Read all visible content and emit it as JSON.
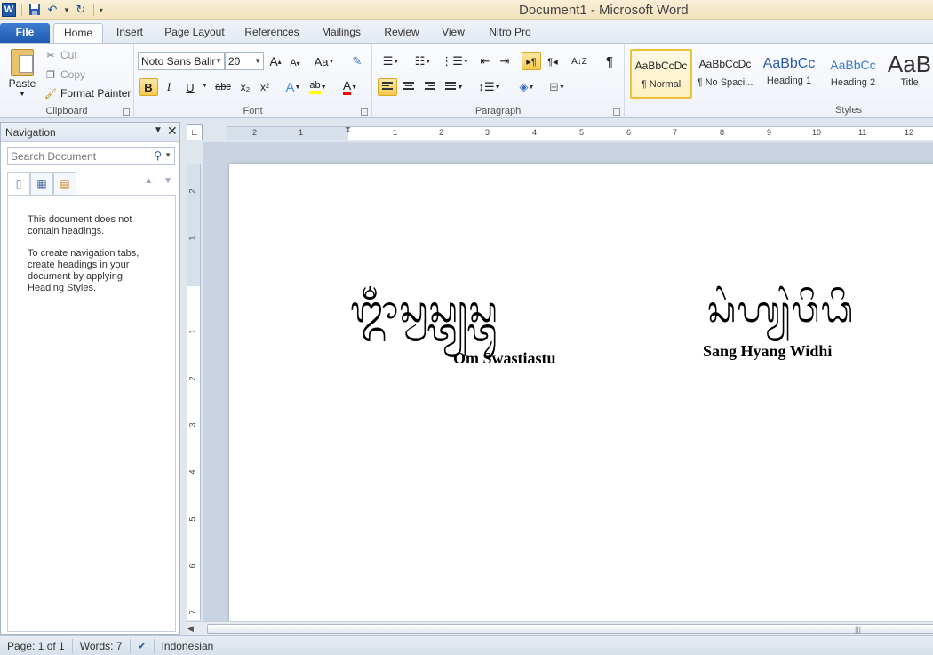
{
  "app": {
    "title": "Document1  -  Microsoft Word",
    "logo": "W"
  },
  "tabs": {
    "file": "File",
    "home": "Home",
    "insert": "Insert",
    "page_layout": "Page Layout",
    "references": "References",
    "mailings": "Mailings",
    "review": "Review",
    "view": "View",
    "nitro": "Nitro Pro"
  },
  "clipboard": {
    "paste": "Paste",
    "cut": "Cut",
    "copy": "Copy",
    "format_painter": "Format Painter",
    "label": "Clipboard"
  },
  "font": {
    "name": "Noto Sans Balir",
    "size": "20",
    "label": "Font",
    "grow": "A",
    "shrink": "A",
    "change_case": "Aa",
    "bold": "B",
    "italic": "I",
    "underline": "U",
    "strikethrough": "abc",
    "subscript": "x₂",
    "superscript": "x²",
    "text_effects": "A",
    "font_color": "A",
    "highlight_color": "#ffff00",
    "font_color_value": "#ff0000"
  },
  "paragraph": {
    "label": "Paragraph",
    "pilcrow": "¶"
  },
  "styles": {
    "label": "Styles",
    "items": [
      {
        "sample": "AaBbCcDc",
        "name": "¶ Normal"
      },
      {
        "sample": "AaBbCcDc",
        "name": "¶ No Spaci..."
      },
      {
        "sample": "AaBbCc",
        "name": "Heading 1"
      },
      {
        "sample": "AaBbCc",
        "name": "Heading 2"
      },
      {
        "sample": "AaB",
        "name": "Title"
      }
    ]
  },
  "navigation": {
    "title": "Navigation",
    "search_placeholder": "Search Document",
    "message1": "This document does not contain headings.",
    "message2": "To create navigation tabs, create headings in your document by applying Heading Styles."
  },
  "ruler": {
    "h_marks": [
      "2",
      "1",
      "1",
      "1",
      "2",
      "3",
      "4",
      "5",
      "6",
      "7",
      "8",
      "9",
      "10",
      "11",
      "12"
    ],
    "v_marks": [
      "2",
      "1",
      "1",
      "2",
      "3",
      "4",
      "5",
      "6",
      "7"
    ]
  },
  "document": {
    "balinese_left": "ᬒᬁᬲ᭄ᬯᬲ᭄ᬢ᭄ᬬᬲ᭄ᬢᬸ",
    "balinese_right": "ᬲᬂᬳ᭄ᬬᬂᬯᬶᬥᬶ",
    "latin_left": "Om Swastiastu",
    "latin_right": "Sang Hyang Widhi"
  },
  "status": {
    "page": "Page: 1 of 1",
    "words": "Words: 7",
    "language": "Indonesian"
  }
}
